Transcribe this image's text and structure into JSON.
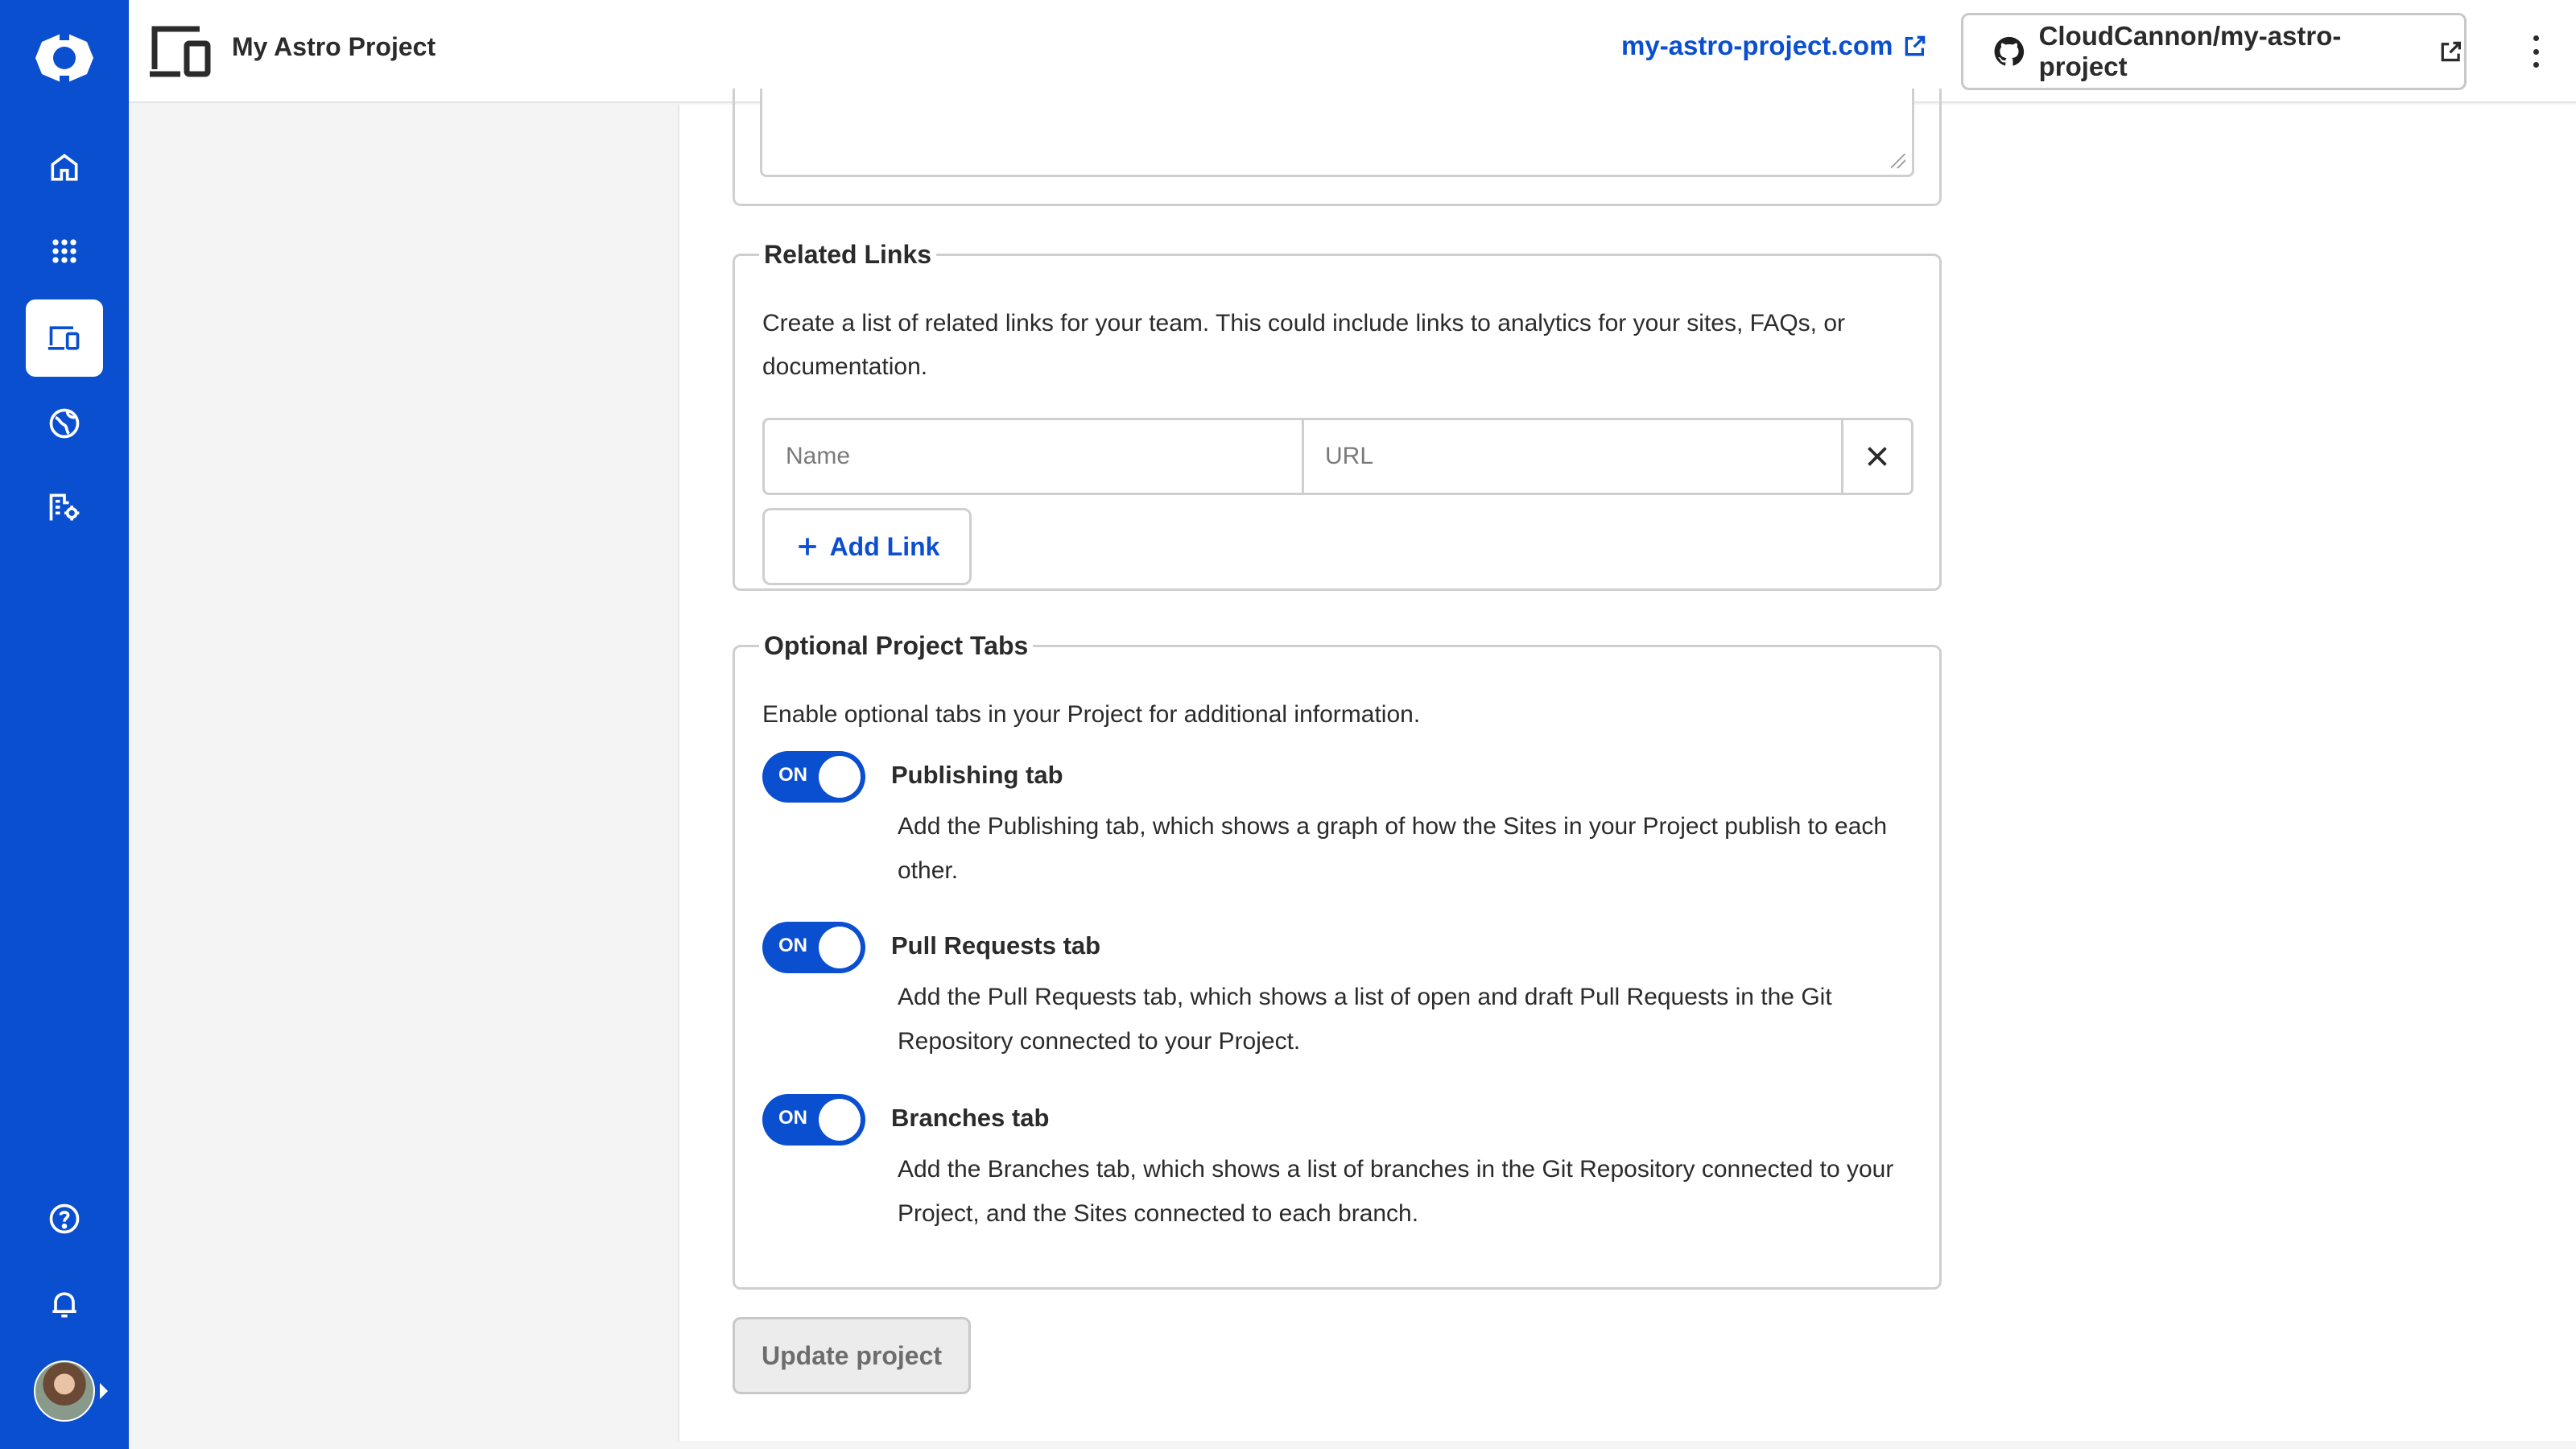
{
  "app": {
    "project_title": "My Astro Project",
    "site_url": "my-astro-project.com",
    "repo_label": "CloudCannon/my-astro-project"
  },
  "colors": {
    "brand_blue": "#0a4fd0",
    "border_gray": "#cfcfcf"
  },
  "sidebar": {
    "icons": [
      "logo-icon",
      "home-icon",
      "apps-grid-icon",
      "devices-icon",
      "globe-icon",
      "organization-settings-icon",
      "help-icon",
      "bell-icon",
      "avatar"
    ]
  },
  "related_links": {
    "legend": "Related Links",
    "description": "Create a list of related links for your team. This could include links to analytics for your sites, FAQs, or documentation.",
    "name_placeholder": "Name",
    "url_placeholder": "URL",
    "add_label": "Add Link"
  },
  "optional_tabs": {
    "legend": "Optional Project Tabs",
    "description": "Enable optional tabs in your Project for additional information.",
    "items": [
      {
        "state": "ON",
        "title": "Publishing tab",
        "description": "Add the Publishing tab, which shows a graph of how the Sites in your Project publish to each other."
      },
      {
        "state": "ON",
        "title": "Pull Requests tab",
        "description": "Add the Pull Requests tab, which shows a list of open and draft Pull Requests in the Git Repository connected to your Project."
      },
      {
        "state": "ON",
        "title": "Branches tab",
        "description": "Add the Branches tab, which shows a list of branches in the Git Repository connected to your Project, and the Sites connected to each branch."
      }
    ]
  },
  "footer": {
    "update_label": "Update project"
  }
}
